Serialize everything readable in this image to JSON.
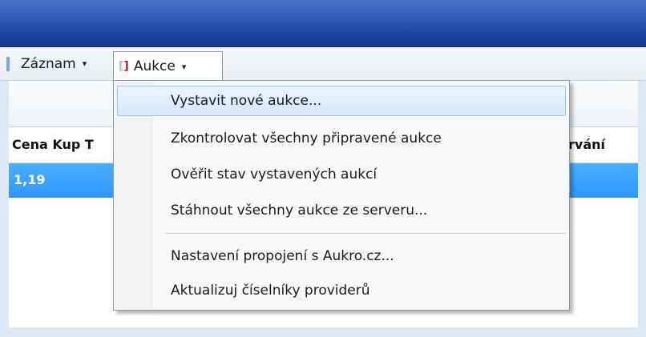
{
  "menubar": {
    "items": [
      {
        "label": "Záznam"
      },
      {
        "label": "Aukce"
      }
    ],
    "caret": "▾",
    "aukce_icon": {
      "left": "[",
      "right": "]"
    }
  },
  "grid": {
    "columns": [
      "Cena Kup T",
      "rvání"
    ],
    "selected_row": {
      "value": "1,19"
    }
  },
  "dropdown": {
    "items": [
      {
        "label": "Vystavit nové aukce..."
      },
      {
        "label": "Zkontrolovat všechny připravené aukce"
      },
      {
        "label": "Ověřit stav vystavených aukcí"
      },
      {
        "label": "Stáhnout všechny aukce ze serveru..."
      },
      {
        "label": "Nastavení propojení s Aukro.cz..."
      },
      {
        "label": "Aktualizuj číselníky providerů"
      }
    ]
  },
  "colors": {
    "titlebar": "#1a47a3",
    "selection": "#2f97fb",
    "hover": "#d7e8fa"
  }
}
